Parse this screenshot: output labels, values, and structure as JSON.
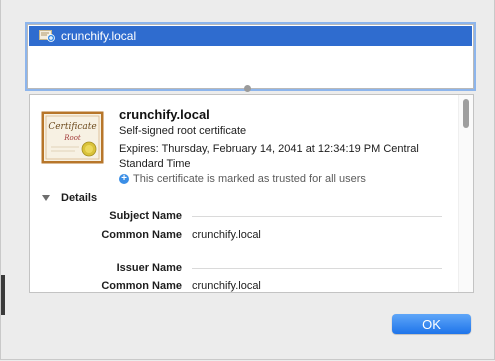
{
  "certificate_list": {
    "items": [
      {
        "label": "crunchify.local",
        "icon": "certificate-icon",
        "selected": true
      }
    ]
  },
  "certificate": {
    "name": "crunchify.local",
    "kind": "Self-signed root certificate",
    "expires": "Expires: Thursday, February 14, 2041 at 12:34:19 PM Central Standard Time",
    "trust_message": "This certificate is marked as trusted for all users",
    "image_text": {
      "title": "Certificate",
      "subtitle": "Root"
    }
  },
  "details": {
    "header": "Details",
    "sections": [
      {
        "title": "Subject Name",
        "fields": [
          {
            "label": "Common Name",
            "value": "crunchify.local"
          }
        ]
      },
      {
        "title": "Issuer Name",
        "fields": [
          {
            "label": "Common Name",
            "value": "crunchify.local"
          }
        ]
      }
    ]
  },
  "buttons": {
    "ok": "OK"
  },
  "colors": {
    "selection": "#2f6ccf",
    "accent": "#3a8ee6",
    "button": "#1e74ea"
  }
}
